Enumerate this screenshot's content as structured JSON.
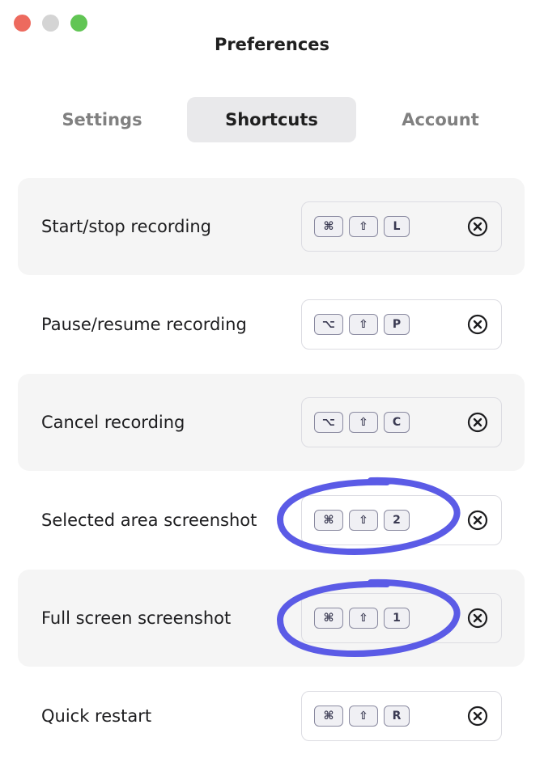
{
  "window": {
    "title": "Preferences",
    "traffic_lights": [
      {
        "name": "close",
        "color": "#ed6a5e"
      },
      {
        "name": "minimize",
        "color": "#d4d4d4"
      },
      {
        "name": "maximize",
        "color": "#61c554"
      }
    ]
  },
  "tabs": [
    {
      "label": "Settings",
      "active": false
    },
    {
      "label": "Shortcuts",
      "active": true
    },
    {
      "label": "Account",
      "active": false
    }
  ],
  "shortcuts": [
    {
      "label": "Start/stop recording",
      "keys": [
        "⌘",
        "⇧",
        "L"
      ],
      "clear_icon": "clear-circle-x-icon"
    },
    {
      "label": "Pause/resume recording",
      "keys": [
        "⌥",
        "⇧",
        "P"
      ],
      "clear_icon": "clear-circle-x-icon"
    },
    {
      "label": "Cancel recording",
      "keys": [
        "⌥",
        "⇧",
        "C"
      ],
      "clear_icon": "clear-circle-x-icon"
    },
    {
      "label": "Selected area screenshot",
      "keys": [
        "⌘",
        "⇧",
        "2"
      ],
      "clear_icon": "clear-circle-x-icon",
      "annotated": true
    },
    {
      "label": "Full screen screenshot",
      "keys": [
        "⌘",
        "⇧",
        "1"
      ],
      "clear_icon": "clear-circle-x-icon",
      "annotated": true
    },
    {
      "label": "Quick restart",
      "keys": [
        "⌘",
        "⇧",
        "R"
      ],
      "clear_icon": "clear-circle-x-icon"
    }
  ],
  "colors": {
    "annotation": "#5b5be6",
    "row_stripe": "#f5f5f5",
    "active_tab": "#e9e9eb"
  }
}
